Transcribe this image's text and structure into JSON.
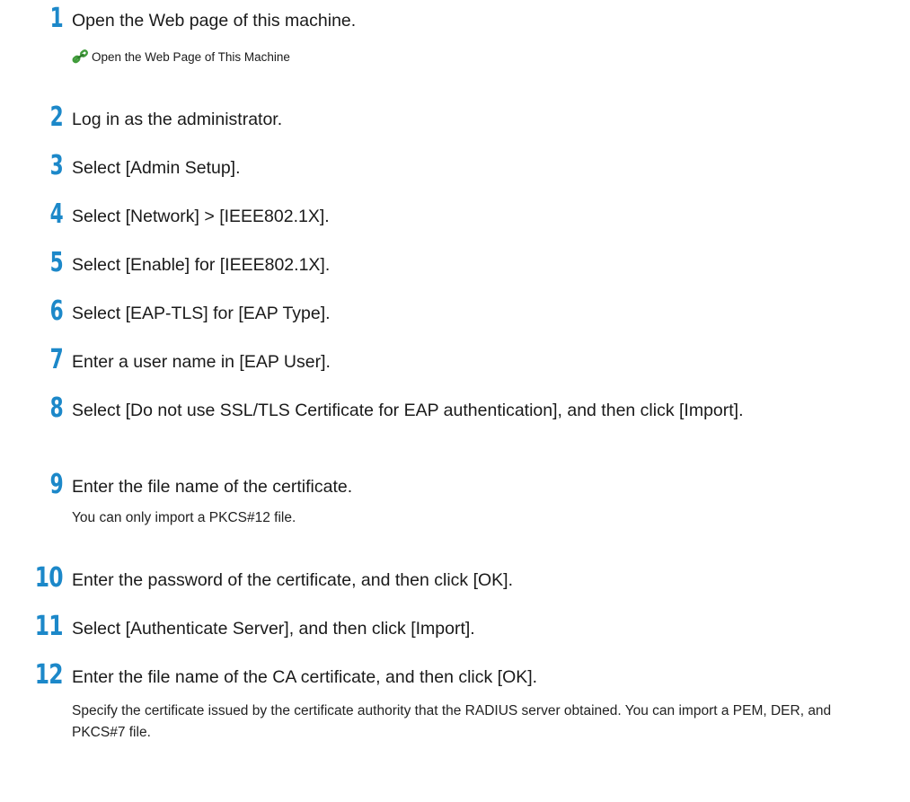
{
  "colors": {
    "step_number": "#1c88c9",
    "text": "#1a1a1a",
    "link_icon": "#3f9b3a"
  },
  "steps": [
    {
      "number": "1",
      "text": "Open the Web page of this machine.",
      "link": {
        "icon": "link-chain-icon",
        "label": "Open the Web Page of This Machine"
      }
    },
    {
      "number": "2",
      "text": "Log in as the administrator."
    },
    {
      "number": "3",
      "text": "Select [Admin Setup]."
    },
    {
      "number": "4",
      "text": "Select [Network] > [IEEE802.1X]."
    },
    {
      "number": "5",
      "text": "Select [Enable] for [IEEE802.1X]."
    },
    {
      "number": "6",
      "text": "Select [EAP-TLS] for [EAP Type]."
    },
    {
      "number": "7",
      "text": "Enter a user name in [EAP User]."
    },
    {
      "number": "8",
      "text": "Select [Do not use SSL/TLS Certificate for EAP authentication], and then click [Import]."
    },
    {
      "number": "9",
      "text": "Enter the file name of the certificate.",
      "note": "You can only import a PKCS#12 file."
    },
    {
      "number": "10",
      "text": "Enter the password of the certificate, and then click [OK]."
    },
    {
      "number": "11",
      "text": "Select [Authenticate Server], and then click [Import]."
    },
    {
      "number": "12",
      "text": "Enter the file name of the CA certificate, and then click [OK].",
      "note": "Specify the certificate issued by the certificate authority that the RADIUS server obtained. You can import a PEM, DER, and PKCS#7 file."
    }
  ]
}
